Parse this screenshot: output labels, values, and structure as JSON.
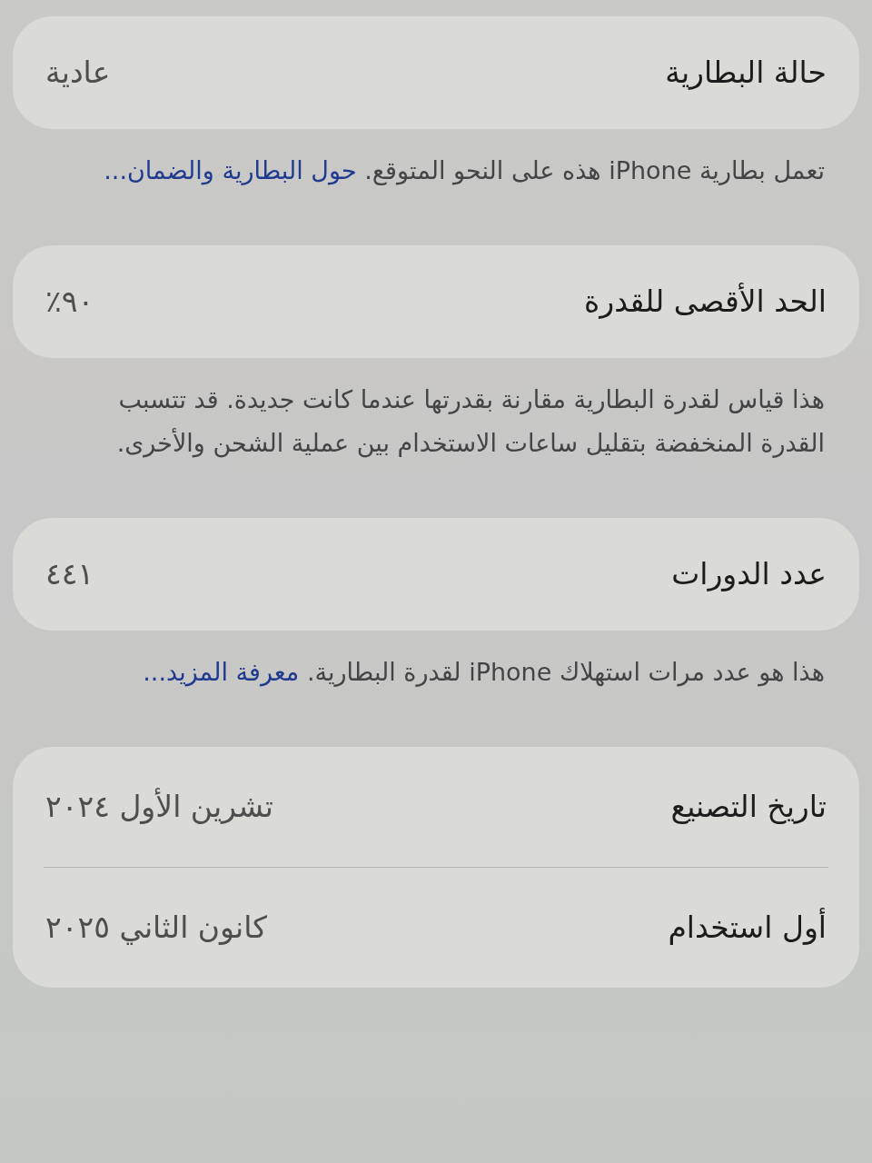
{
  "sections": [
    {
      "rows": [
        {
          "label": "حالة البطارية",
          "value": "عادية"
        }
      ],
      "footer": {
        "text": "تعمل بطارية iPhone هذه على النحو المتوقع.",
        "link": "حول البطارية والضمان..."
      }
    },
    {
      "rows": [
        {
          "label": "الحد الأقصى للقدرة",
          "value": "٩٠٪"
        }
      ],
      "footer": {
        "text": "هذا قياس لقدرة البطارية مقارنة بقدرتها عندما كانت جديدة. قد تتسبب القدرة المنخفضة بتقليل ساعات الاستخدام بين عملية الشحن والأخرى."
      }
    },
    {
      "rows": [
        {
          "label": "عدد الدورات",
          "value": "٤٤١"
        }
      ],
      "footer": {
        "text": "هذا هو عدد مرات استهلاك iPhone لقدرة البطارية.",
        "link": "معرفة المزيد..."
      }
    },
    {
      "rows": [
        {
          "label": "تاريخ التصنيع",
          "value": "تشرين الأول ٢٠٢٤"
        },
        {
          "label": "أول استخدام",
          "value": "كانون الثاني ٢٠٢٥"
        }
      ]
    }
  ]
}
